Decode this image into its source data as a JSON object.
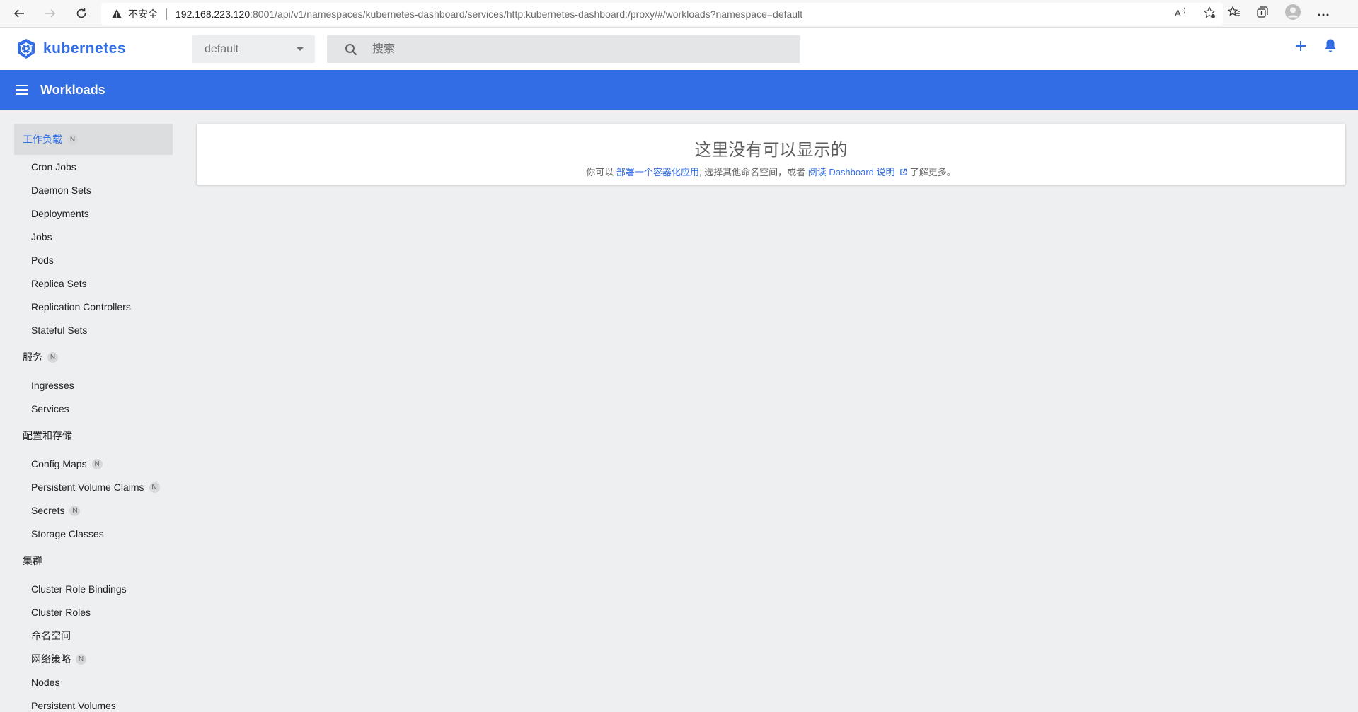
{
  "browser": {
    "insecure_label": "不安全",
    "url_host": "192.168.223.120",
    "url_rest": ":8001/api/v1/namespaces/kubernetes-dashboard/services/http:kubernetes-dashboard:/proxy/#/workloads?namespace=default"
  },
  "header": {
    "brand": "kubernetes",
    "namespace": "default",
    "search_placeholder": "搜索"
  },
  "toolbar": {
    "title": "Workloads"
  },
  "sidebar": {
    "groups": [
      {
        "label": "工作负载",
        "badge": "N"
      },
      {
        "label": "服务",
        "badge": "N"
      },
      {
        "label": "配置和存储"
      },
      {
        "label": "集群"
      }
    ],
    "workloads": [
      "Cron Jobs",
      "Daemon Sets",
      "Deployments",
      "Jobs",
      "Pods",
      "Replica Sets",
      "Replication Controllers",
      "Stateful Sets"
    ],
    "services": [
      "Ingresses",
      "Services"
    ],
    "config": [
      {
        "label": "Config Maps",
        "badge": "N"
      },
      {
        "label": "Persistent Volume Claims",
        "badge": "N"
      },
      {
        "label": "Secrets",
        "badge": "N"
      },
      {
        "label": "Storage Classes"
      }
    ],
    "cluster": [
      {
        "label": "Cluster Role Bindings"
      },
      {
        "label": "Cluster Roles"
      },
      {
        "label": "命名空间"
      },
      {
        "label": "网络策略",
        "badge": "N"
      },
      {
        "label": "Nodes"
      },
      {
        "label": "Persistent Volumes"
      }
    ]
  },
  "main": {
    "empty_title": "这里没有可以显示的",
    "sub_prefix": "你可以 ",
    "deploy_link": "部署一个容器化应用",
    "sub_middle": ", 选择其他命名空间，或者 ",
    "docs_link": "阅读 Dashboard 说明",
    "sub_suffix": " 了解更多。"
  },
  "colors": {
    "brand": "#326de6",
    "background": "#eeeff1"
  }
}
